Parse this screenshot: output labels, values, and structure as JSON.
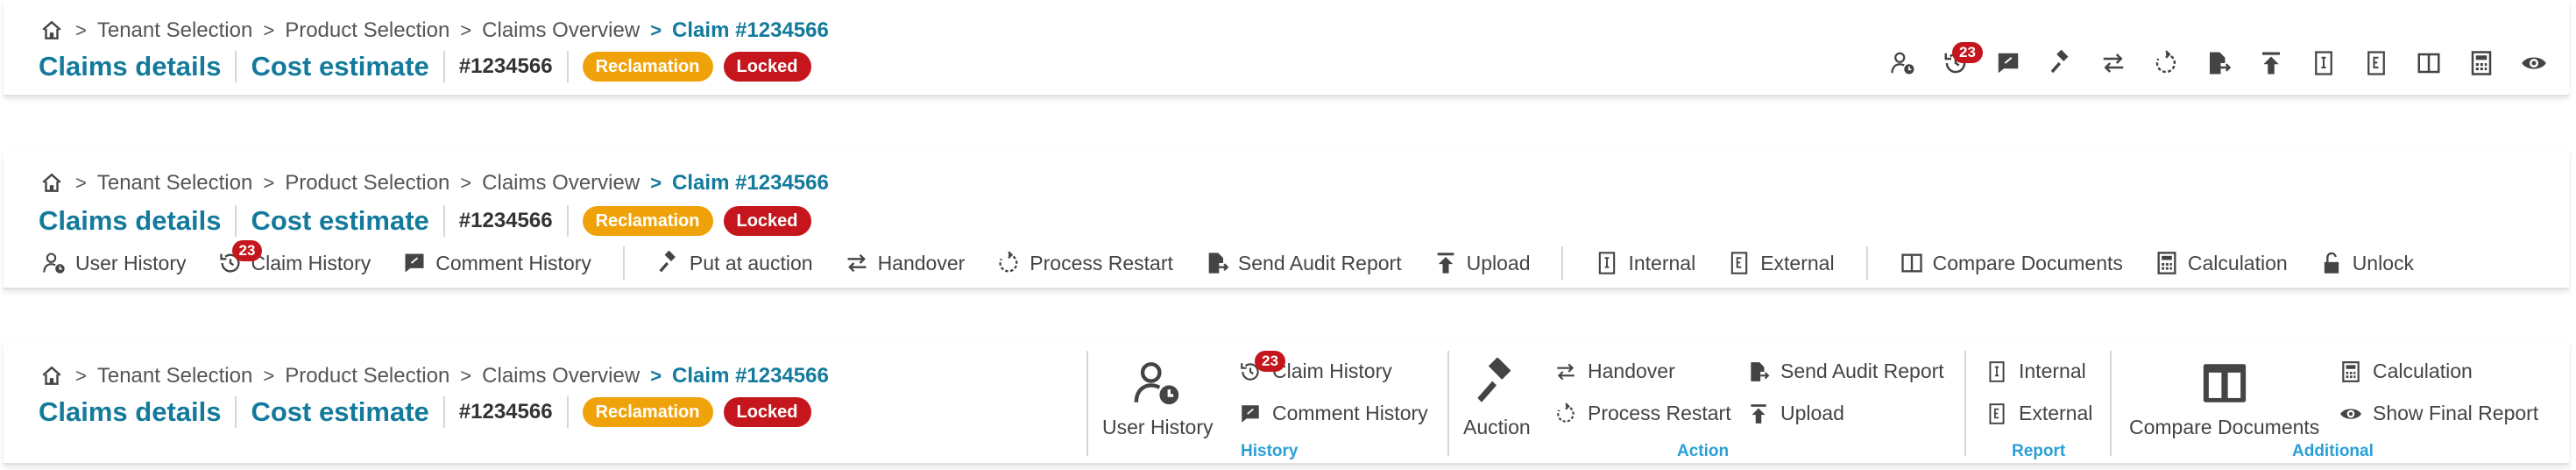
{
  "breadcrumb": {
    "home_icon": "home-icon",
    "items": [
      "Tenant Selection",
      "Product Selection",
      "Claims Overview",
      "Claim #1234566"
    ]
  },
  "header": {
    "tab_claims_details": "Claims details",
    "tab_cost_estimate": "Cost estimate",
    "claim_number": "#1234566",
    "badge_reclamation": "Reclamation",
    "badge_locked": "Locked"
  },
  "colors": {
    "accent": "#137a9c",
    "reclamation": "#f0a20a",
    "locked": "#c4161c",
    "group_label": "#2a9fd6"
  },
  "claim_history_count": "23",
  "toolbar": {
    "user_history": "User History",
    "claim_history": "Claim History",
    "comment_history": "Comment History",
    "put_at_auction": "Put at auction",
    "handover": "Handover",
    "process_restart": "Process Restart",
    "send_audit_report": "Send Audit Report",
    "upload": "Upload",
    "internal": "Internal",
    "external": "External",
    "compare_documents": "Compare Documents",
    "calculation": "Calculation",
    "unlock": "Unlock"
  },
  "ribbon": {
    "user_history": "User History",
    "claim_history": "Claim History",
    "comment_history": "Comment History",
    "auction": "Auction",
    "handover": "Handover",
    "process_restart": "Process Restart",
    "send_audit_report": "Send Audit Report",
    "upload": "Upload",
    "internal": "Internal",
    "external": "External",
    "compare_documents": "Compare Documents",
    "calculation": "Calculation",
    "show_final_report": "Show Final Report",
    "group_history": "History",
    "group_action": "Action",
    "group_report": "Report",
    "group_additional": "Additional"
  }
}
